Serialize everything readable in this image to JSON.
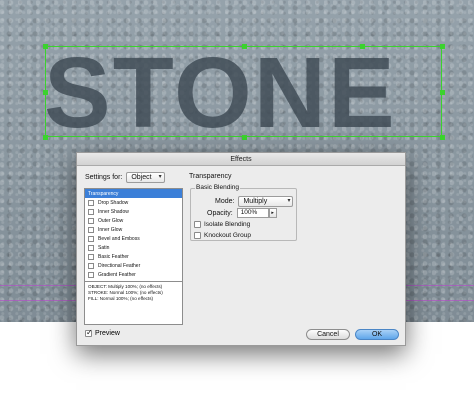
{
  "artwork": {
    "text": "STONE"
  },
  "dialog": {
    "title": "Effects",
    "settings_for_label": "Settings for:",
    "settings_for_value": "Object",
    "effects": [
      {
        "label": "Transparency",
        "selected": true,
        "has_checkbox": false
      },
      {
        "label": "Drop Shadow",
        "selected": false,
        "has_checkbox": true
      },
      {
        "label": "Inner Shadow",
        "selected": false,
        "has_checkbox": true
      },
      {
        "label": "Outer Glow",
        "selected": false,
        "has_checkbox": true
      },
      {
        "label": "Inner Glow",
        "selected": false,
        "has_checkbox": true
      },
      {
        "label": "Bevel and Emboss",
        "selected": false,
        "has_checkbox": true
      },
      {
        "label": "Satin",
        "selected": false,
        "has_checkbox": true
      },
      {
        "label": "Basic Feather",
        "selected": false,
        "has_checkbox": true
      },
      {
        "label": "Directional Feather",
        "selected": false,
        "has_checkbox": true
      },
      {
        "label": "Gradient Feather",
        "selected": false,
        "has_checkbox": true
      }
    ],
    "summary": [
      "OBJECT: Multiply 100%; (no effects)",
      "STROKE: Normal 100%; (no effects)",
      "FILL: Normal 100%; (no effects)"
    ],
    "panel_title": "Transparency",
    "basic_blending_title": "Basic Blending",
    "mode_label": "Mode:",
    "mode_value": "Multiply",
    "opacity_label": "Opacity:",
    "opacity_value": "100%",
    "isolate_blending_label": "Isolate Blending",
    "knockout_group_label": "Knockout Group",
    "preview_label": "Preview",
    "preview_checked": true,
    "cancel_label": "Cancel",
    "ok_label": "OK"
  },
  "colors": {
    "selection": "#3bd22e",
    "guide": "#b04fc4",
    "list_selected": "#3b7fd8",
    "ok_button": "#5fa6ea"
  }
}
